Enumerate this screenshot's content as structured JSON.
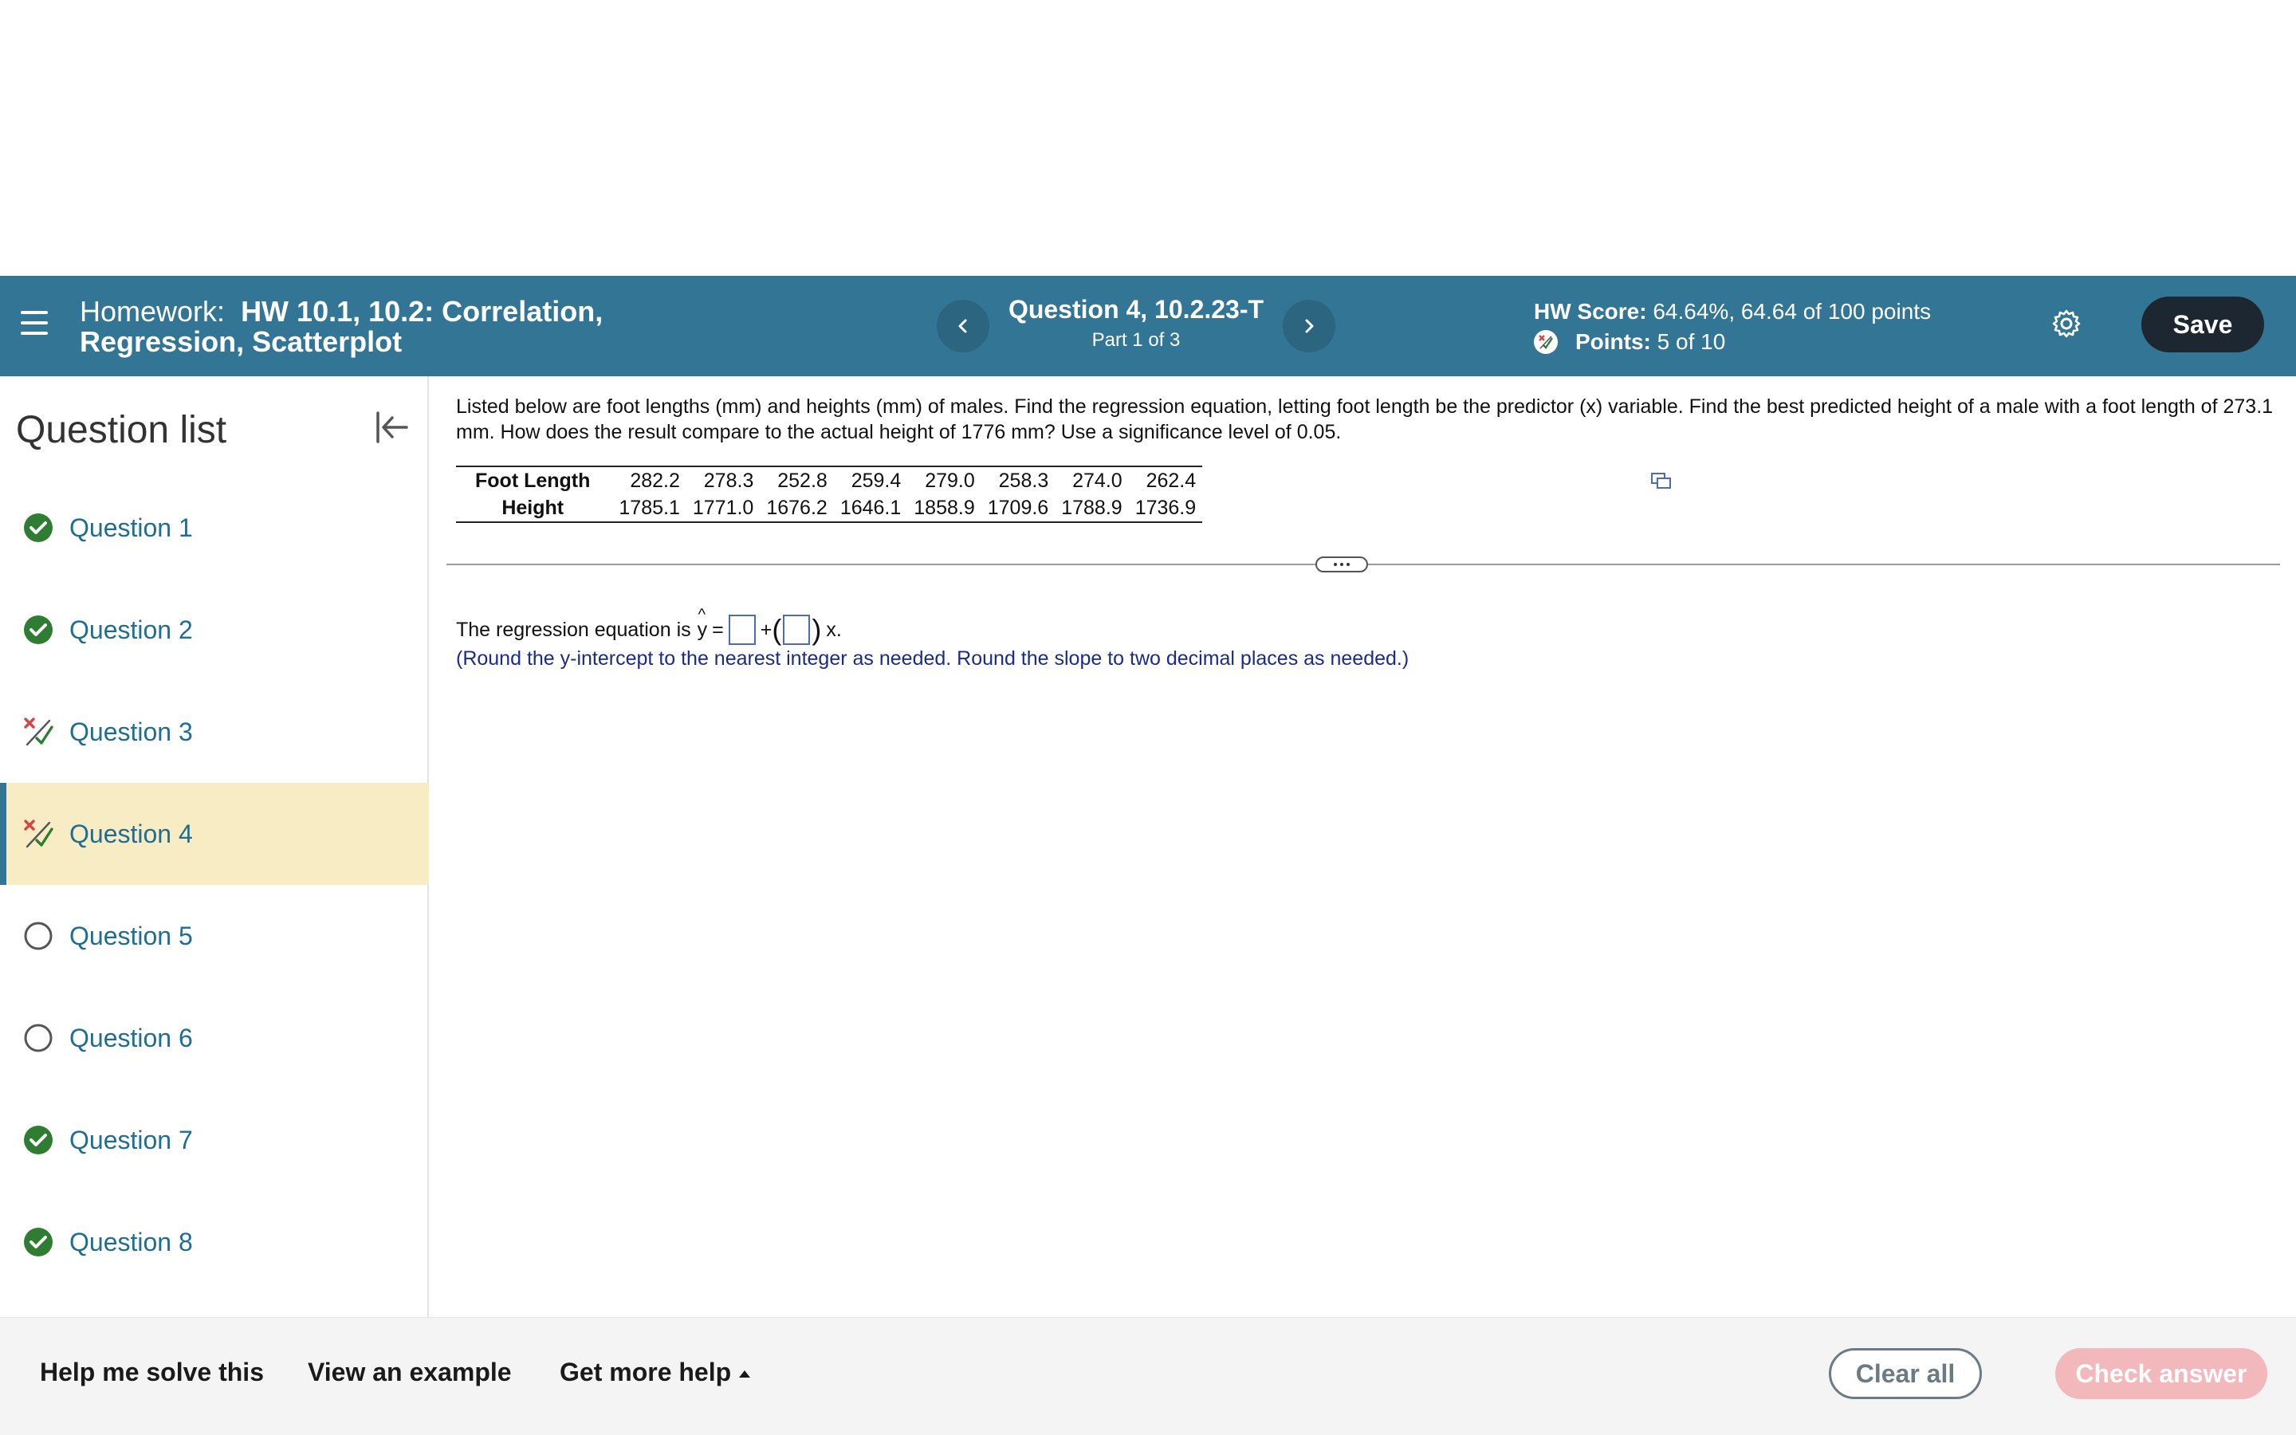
{
  "header": {
    "homework_prefix": "Homework:",
    "homework_name": "HW 10.1, 10.2: Correlation, Regression, Scatterplot",
    "question_title": "Question 4, 10.2.23-T",
    "question_part": "Part 1 of 3",
    "hw_score_label": "HW Score:",
    "hw_score_value": "64.64%, 64.64 of 100 points",
    "points_label": "Points:",
    "points_value": "5 of 10",
    "save_label": "Save"
  },
  "sidebar": {
    "title": "Question list",
    "items": [
      {
        "label": "Question 1",
        "status": "correct"
      },
      {
        "label": "Question 2",
        "status": "correct"
      },
      {
        "label": "Question 3",
        "status": "partial"
      },
      {
        "label": "Question 4",
        "status": "partial"
      },
      {
        "label": "Question 5",
        "status": "unanswered"
      },
      {
        "label": "Question 6",
        "status": "unanswered"
      },
      {
        "label": "Question 7",
        "status": "correct"
      },
      {
        "label": "Question 8",
        "status": "correct"
      }
    ],
    "active_index": 3
  },
  "question": {
    "prompt": "Listed below are foot lengths (mm) and heights (mm) of males. Find the regression equation, letting foot length be the predictor (x) variable. Find the best predicted height of a male with a foot length of 273.1 mm. How does the result compare to the actual height of 1776 mm? Use a significance level of 0.05.",
    "table": {
      "rows": [
        {
          "label": "Foot Length",
          "values": [
            "282.2",
            "278.3",
            "252.8",
            "259.4",
            "279.0",
            "258.3",
            "274.0",
            "262.4"
          ]
        },
        {
          "label": "Height",
          "values": [
            "1785.1",
            "1771.0",
            "1676.2",
            "1646.1",
            "1858.9",
            "1709.6",
            "1788.9",
            "1736.9"
          ]
        }
      ]
    },
    "answer": {
      "lead": "The regression equation is",
      "y_symbol": "y",
      "equals": "=",
      "plus": "+",
      "open_paren": "(",
      "close_paren": ")",
      "x_suffix": "x.",
      "intercept_value": "",
      "slope_value": "",
      "hint": "(Round the y-intercept to the nearest integer as needed. Round the slope to two decimal places as needed.)"
    }
  },
  "footer": {
    "help_me_solve": "Help me solve this",
    "view_example": "View an example",
    "get_more_help": "Get more help",
    "clear_all": "Clear all",
    "check_answer": "Check answer"
  },
  "colors": {
    "header_bg": "#337594",
    "correct": "#2e7d32",
    "partial_x": "#d64545",
    "active_row_bg": "#f8ecc4",
    "hint_text": "#1a2b8c",
    "check_btn": "#f2b8bc"
  },
  "icons": {
    "menu": "hamburger-icon",
    "prev": "chevron-left-icon",
    "next": "chevron-right-icon",
    "settings": "gear-icon",
    "collapse": "collapse-left-icon",
    "copy": "copy-icon"
  }
}
